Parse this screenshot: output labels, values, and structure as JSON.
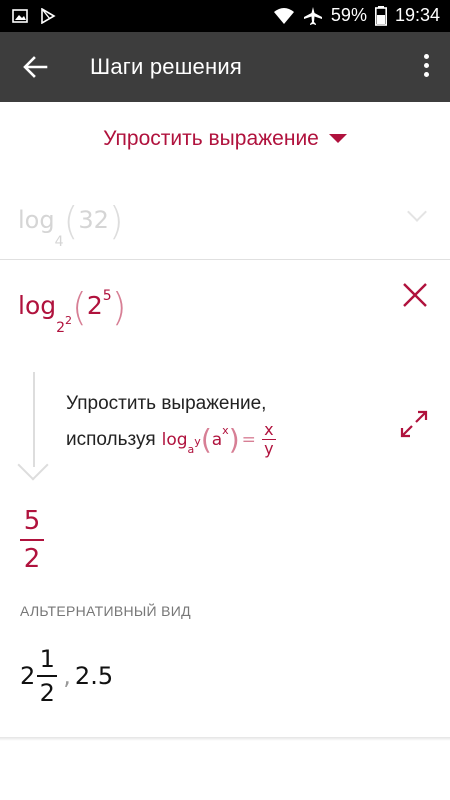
{
  "status_bar": {
    "battery": "59%",
    "time": "19:34"
  },
  "app_bar": {
    "title": "Шаги решения"
  },
  "dropdown": {
    "label": "Упростить выражение"
  },
  "previous_step": {
    "func": "log",
    "base": "4",
    "open": "(",
    "arg": "32",
    "close": ")"
  },
  "current_step": {
    "func": "log",
    "base": "2",
    "base_exp": "2",
    "arg": "2",
    "arg_exp": "5",
    "open": "(",
    "close": ")"
  },
  "explanation": {
    "line1": "Упростить выражение,",
    "line2": "используя",
    "rule": {
      "func": "log",
      "base": "a",
      "base_exp": "y",
      "arg": "a",
      "arg_exp": "x",
      "equals": "=",
      "num": "x",
      "den": "y"
    }
  },
  "result": {
    "numerator": "5",
    "denominator": "2"
  },
  "alternative": {
    "label": "АЛЬТЕРНАТИВНЫЙ ВИД",
    "whole": "2",
    "numerator": "1",
    "denominator": "2",
    "separator": ",",
    "decimal": "2.5"
  }
}
